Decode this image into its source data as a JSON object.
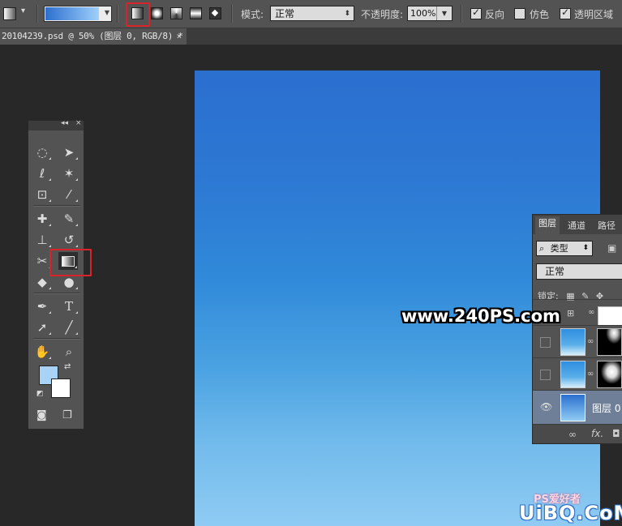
{
  "options_bar": {
    "mode_label": "模式:",
    "mode_value": "正常",
    "opacity_label": "不透明度:",
    "opacity_value": "100%",
    "checkboxes": [
      {
        "label": "反向",
        "checked": true
      },
      {
        "label": "仿色",
        "checked": false
      },
      {
        "label": "透明区域",
        "checked": true
      }
    ],
    "gradient_colors": [
      "#2d6fcf",
      "#9fd0fb"
    ]
  },
  "document_tab": {
    "title": "20104239.psd @ 50% (图层 0, RGB/8) *",
    "close": "×"
  },
  "toolbox": {
    "collapse": "◂◂",
    "close": "×",
    "type_tool_glyph": "T",
    "foreground_color": "#a9d3f6",
    "background_color": "#ffffff"
  },
  "layers_panel": {
    "tabs": [
      "图层",
      "通道",
      "路径"
    ],
    "kind_filter_label": "类型",
    "blend_mode": "正常",
    "lock_label": "锁定:",
    "layers": [
      {
        "name": "",
        "visible": false,
        "has_mask": true
      },
      {
        "name": "",
        "visible": false,
        "has_mask": true
      },
      {
        "name": "",
        "visible": false,
        "has_mask": true
      },
      {
        "name": "图层 0",
        "visible": true,
        "has_mask": false,
        "selected": true
      }
    ],
    "footer_fx": "fx."
  },
  "watermark": {
    "url": "www.240PS.com",
    "logo_text": "UiBQ.CoM",
    "logo_sub": "PS爱好者"
  }
}
